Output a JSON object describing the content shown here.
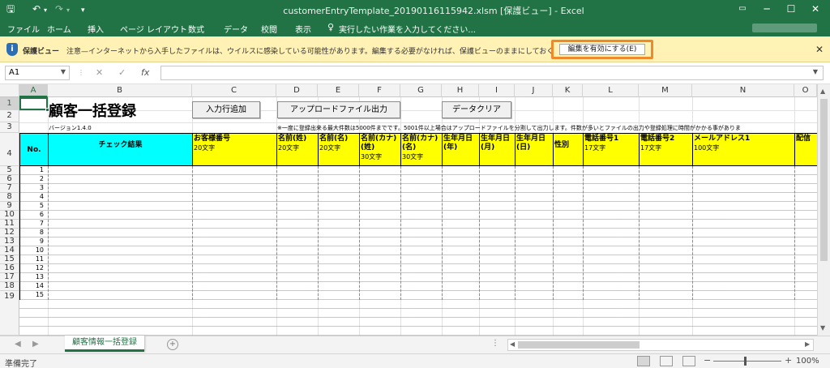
{
  "window": {
    "title": "customerEntryTemplate_20190116115942.xlsm [保護ビュー] - Excel",
    "save_icon": "save-icon",
    "undo_icon": "undo-icon",
    "redo_icon": "redo-icon",
    "qat_icon": "customize-qat-icon",
    "ribbon_display_icon": "ribbon-display-options-icon",
    "minimize_label": "─",
    "maximize_label": "☐",
    "close_label": "✕"
  },
  "ribbon": {
    "tabs": [
      "ファイル",
      "ホーム",
      "挿入",
      "ページ レイアウト",
      "数式",
      "データ",
      "校閲",
      "表示"
    ],
    "tell_me_placeholder": "実行したい作業を入力してください...",
    "tell_me_icon": "lightbulb-icon"
  },
  "protected_view": {
    "title": "保護ビュー",
    "message": "注意—インターネットから入手したファイルは、ウイルスに感染している可能性があります。編集する必要がなければ、保護ビューのままにしておくことをお勧めします。",
    "enable_button": "編集を有効にする(E)",
    "shield_icon": "shield-icon",
    "close_icon": "close-icon",
    "highlight_color": "#ed8a2c"
  },
  "formula_bar": {
    "name_box": "A1",
    "formula_value": "",
    "cancel_icon": "cancel-icon",
    "enter_icon": "enter-icon",
    "fx_label": "fx"
  },
  "columns": [
    "A",
    "B",
    "C",
    "D",
    "E",
    "F",
    "G",
    "H",
    "I",
    "J",
    "K",
    "L",
    "M",
    "N",
    "O"
  ],
  "rows": [
    "1",
    "2",
    "3",
    "4",
    "5",
    "6",
    "7",
    "8",
    "9",
    "10",
    "11",
    "12",
    "13",
    "14",
    "15",
    "16",
    "17",
    "18",
    "19"
  ],
  "sheet": {
    "title": "顧客一括登録",
    "version": "バージョン1.4.0",
    "buttons": {
      "add_row": "入力行追加",
      "upload_output": "アップロードファイル出力",
      "clear_data": "データクリア"
    },
    "note": "※一度に登録出来る最大件数は5000件までです。5001件以上場合はアップロードファイルを分割して出力します。件数が多いとファイルの出力や登録処理に時間がかかる事がありま",
    "headers": {
      "no": "No.",
      "check_result": "チェック結果",
      "customer_no": {
        "name": "お客様番号",
        "limit": "20文字"
      },
      "last_name": {
        "name": "名前(姓)",
        "limit": "20文字"
      },
      "first_name": {
        "name": "名前(名)",
        "limit": "20文字"
      },
      "last_name_kana": {
        "name": "名前(カナ)(姓)",
        "limit": "30文字"
      },
      "first_name_kana": {
        "name": "名前(カナ)(名)",
        "limit": "30文字"
      },
      "birth_year": {
        "name": "生年月日(年)"
      },
      "birth_month": {
        "name": "生年月日(月)"
      },
      "birth_day": {
        "name": "生年月日(日)"
      },
      "gender": {
        "name": "性別"
      },
      "phone1": {
        "name": "電話番号1",
        "limit": "17文字"
      },
      "phone2": {
        "name": "電話番号2",
        "limit": "17文字"
      },
      "email1": {
        "name": "メールアドレス1",
        "limit": "100文字"
      },
      "delivery": {
        "name": "配信"
      }
    },
    "row_numbers": [
      "1",
      "2",
      "3",
      "4",
      "5",
      "6",
      "7",
      "8",
      "9",
      "10",
      "11",
      "12",
      "13",
      "14",
      "15"
    ]
  },
  "sheet_tabs": {
    "active": "顧客情報一括登録",
    "add_icon": "add-sheet-icon",
    "nav_prev": "◀",
    "nav_next": "▶"
  },
  "status_bar": {
    "status": "準備完了",
    "zoom": "100%",
    "zoom_minus": "−",
    "zoom_plus": "+"
  },
  "colors": {
    "excel_green": "#217346",
    "header_yellow": "#ffff00",
    "header_cyan": "#00ffff",
    "protected_bar": "#fff2b4"
  }
}
